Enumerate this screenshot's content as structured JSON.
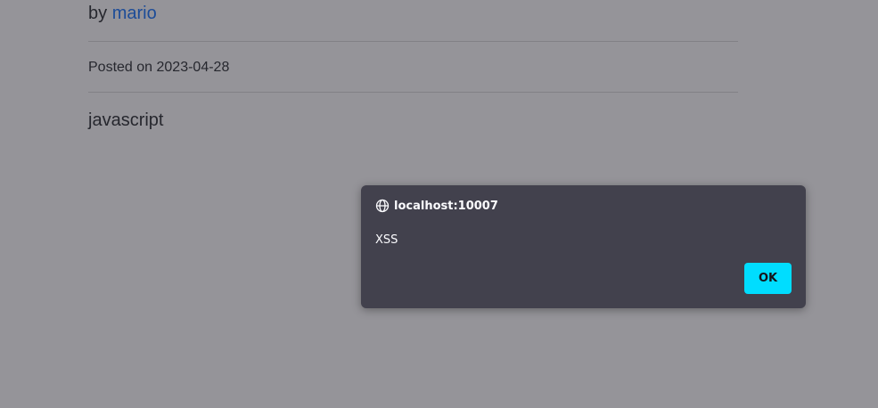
{
  "post": {
    "by_prefix": "by",
    "author": "mario",
    "posted": "Posted on 2023-04-28",
    "content": "javascript"
  },
  "dialog": {
    "origin": "localhost:10007",
    "origin_icon": "globe-icon",
    "message": "XSS",
    "ok_label": "OK",
    "button_color": "#00ddff",
    "background_color": "#42414d"
  }
}
